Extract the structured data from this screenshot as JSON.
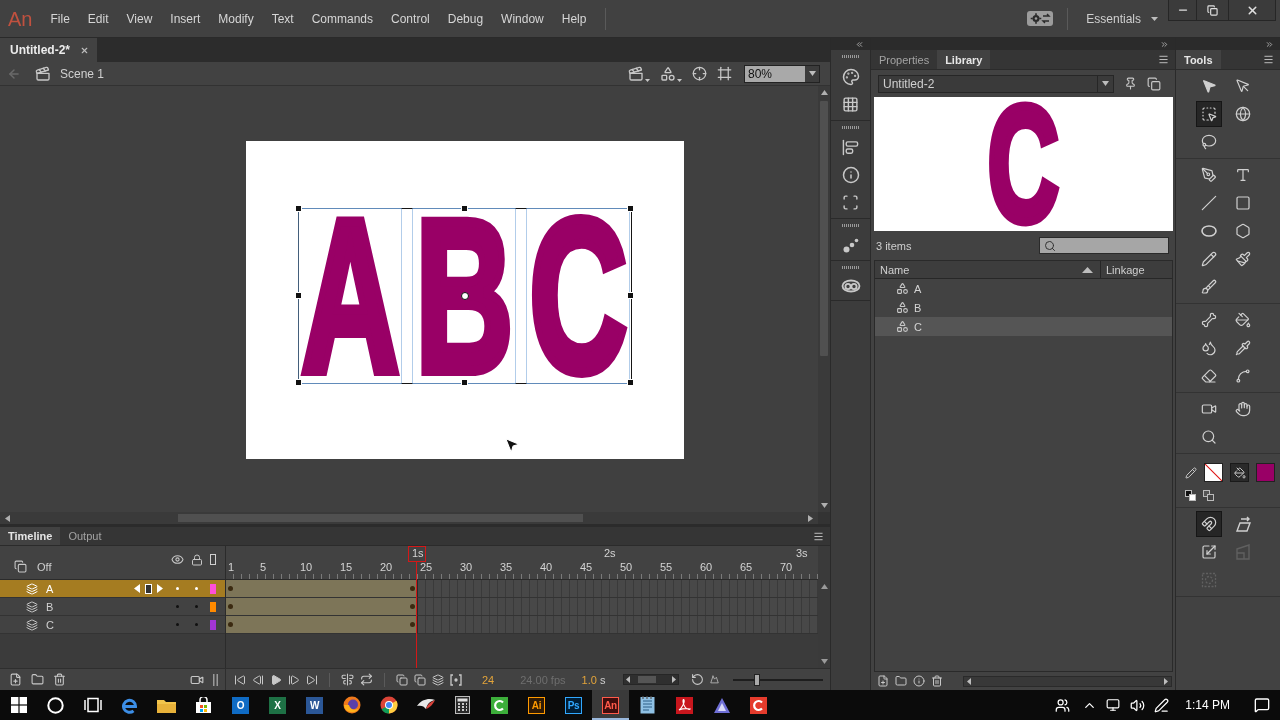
{
  "menu_bar": {
    "logo": "An",
    "items": [
      "File",
      "Edit",
      "View",
      "Insert",
      "Modify",
      "Text",
      "Commands",
      "Control",
      "Debug",
      "Window",
      "Help"
    ],
    "workspace": "Essentials"
  },
  "document_tabs": [
    {
      "label": "Untitled-2*",
      "selected": true
    }
  ],
  "edit_bar": {
    "scene": "Scene 1",
    "zoom": "80%"
  },
  "stage": {
    "symbols": [
      "A",
      "B",
      "C"
    ]
  },
  "timeline": {
    "tabs": [
      {
        "label": "Timeline",
        "selected": true
      },
      {
        "label": "Output",
        "selected": false
      }
    ],
    "onion_skin": "Off",
    "seconds": [
      "1s",
      "2s",
      "3s"
    ],
    "frame_numbers": [
      "1",
      "5",
      "10",
      "15",
      "20",
      "25",
      "30",
      "35",
      "40",
      "45",
      "50",
      "55",
      "60",
      "65",
      "70"
    ],
    "layers": [
      {
        "name": "A",
        "selected": true,
        "color": "#ff4fd8"
      },
      {
        "name": "B",
        "selected": false,
        "color": "#ff8a00"
      },
      {
        "name": "C",
        "selected": false,
        "color": "#a235d4"
      }
    ],
    "current_frame": "24",
    "frame_rate": "24.00 fps",
    "elapsed": "1.0",
    "elapsed_unit": "s",
    "frame_zoom": {
      "level": 0.25
    }
  },
  "library": {
    "tabs": [
      {
        "label": "Properties",
        "selected": false
      },
      {
        "label": "Library",
        "selected": true
      }
    ],
    "document": "Untitled-2",
    "preview": "C",
    "count": "3 items",
    "columns": [
      "Name",
      "Linkage"
    ],
    "items": [
      {
        "name": "A",
        "selected": false
      },
      {
        "name": "B",
        "selected": false
      },
      {
        "name": "C",
        "selected": true
      }
    ]
  },
  "tools": {
    "title": "Tools",
    "groups": [
      {
        "tools": [
          {
            "kind": "selection",
            "selected": false
          },
          {
            "kind": "subselection",
            "selected": false
          },
          {
            "kind": "transform",
            "selected": true
          },
          {
            "kind": "rotation",
            "selected": false
          },
          {
            "kind": "lasso",
            "selected": false
          }
        ]
      },
      {
        "tools": [
          {
            "kind": "pen",
            "selected": false
          },
          {
            "kind": "text",
            "selected": false
          },
          {
            "kind": "line",
            "selected": false
          },
          {
            "kind": "rectangle",
            "selected": false
          },
          {
            "kind": "oval",
            "selected": false
          },
          {
            "kind": "polystar",
            "selected": false
          },
          {
            "kind": "pencil",
            "selected": false
          },
          {
            "kind": "paintbrush",
            "selected": false
          },
          {
            "kind": "brush",
            "selected": false
          }
        ]
      },
      {
        "tools": [
          {
            "kind": "bone",
            "selected": false
          },
          {
            "kind": "bucket",
            "selected": false
          },
          {
            "kind": "inkbottle",
            "selected": false
          },
          {
            "kind": "eyedropper",
            "selected": false
          },
          {
            "kind": "eraser",
            "selected": false
          },
          {
            "kind": "width",
            "selected": false
          }
        ]
      },
      {
        "tools": [
          {
            "kind": "camera",
            "selected": false
          },
          {
            "kind": "hand",
            "selected": false
          },
          {
            "kind": "zoom",
            "selected": false
          }
        ]
      }
    ],
    "colors": {
      "stroke": {
        "kind": "none"
      },
      "fill": {
        "color": "#990066"
      }
    },
    "options": [
      {
        "kind": "snap",
        "selected": true,
        "disabled": false
      },
      {
        "kind": "skew",
        "selected": false,
        "disabled": false
      },
      {
        "kind": "scale",
        "selected": false,
        "disabled": false
      },
      {
        "kind": "distort",
        "selected": false,
        "disabled": true
      },
      {
        "kind": "envelope",
        "selected": false,
        "disabled": true
      }
    ]
  },
  "taskbar": {
    "apps": [
      {
        "kind": "start",
        "selected": false
      },
      {
        "kind": "search",
        "selected": false
      },
      {
        "kind": "taskview",
        "selected": false
      },
      {
        "kind": "edge",
        "selected": false
      },
      {
        "kind": "folder",
        "selected": false
      },
      {
        "kind": "store",
        "selected": false
      },
      {
        "kind": "outlook",
        "label": "O",
        "selected": false
      },
      {
        "kind": "excel",
        "label": "X",
        "selected": false
      },
      {
        "kind": "word",
        "label": "W",
        "selected": false
      },
      {
        "kind": "firefox",
        "selected": false
      },
      {
        "kind": "chrome",
        "selected": false
      },
      {
        "kind": "wing",
        "selected": false
      },
      {
        "kind": "calculator",
        "selected": false
      },
      {
        "kind": "camtasia",
        "selected": false
      },
      {
        "kind": "illustrator",
        "label": "Ai",
        "selected": false
      },
      {
        "kind": "photoshop",
        "label": "Ps",
        "selected": false
      },
      {
        "kind": "animate",
        "label": "An",
        "selected": true
      },
      {
        "kind": "notepad",
        "selected": false
      },
      {
        "kind": "acrobat",
        "selected": false
      },
      {
        "kind": "triangle",
        "selected": false
      },
      {
        "kind": "recorder",
        "selected": false
      }
    ],
    "time": "1:14 PM"
  }
}
